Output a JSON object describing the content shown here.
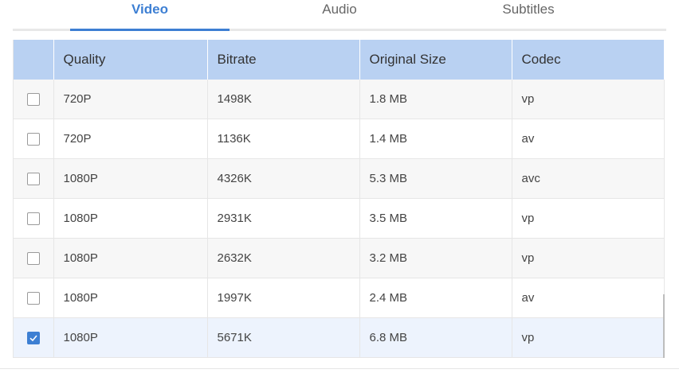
{
  "tabs": [
    {
      "label": "Video",
      "active": true
    },
    {
      "label": "Audio",
      "active": false
    },
    {
      "label": "Subtitles",
      "active": false
    }
  ],
  "table": {
    "headers": [
      "Quality",
      "Bitrate",
      "Original Size",
      "Codec"
    ],
    "rows": [
      {
        "quality": "720P",
        "bitrate": "1498K",
        "size": "1.8 MB",
        "codec": "vp",
        "checked": false
      },
      {
        "quality": "720P",
        "bitrate": "1136K",
        "size": "1.4 MB",
        "codec": "av",
        "checked": false
      },
      {
        "quality": "1080P",
        "bitrate": "4326K",
        "size": "5.3 MB",
        "codec": "avc",
        "checked": false
      },
      {
        "quality": "1080P",
        "bitrate": "2931K",
        "size": "3.5 MB",
        "codec": "vp",
        "checked": false
      },
      {
        "quality": "1080P",
        "bitrate": "2632K",
        "size": "3.2 MB",
        "codec": "vp",
        "checked": false
      },
      {
        "quality": "1080P",
        "bitrate": "1997K",
        "size": "2.4 MB",
        "codec": "av",
        "checked": false
      },
      {
        "quality": "1080P",
        "bitrate": "5671K",
        "size": "6.8 MB",
        "codec": "vp",
        "checked": true
      }
    ]
  },
  "colors": {
    "accent": "#3d7fd3",
    "header_bg": "#b9d1f2",
    "selected_row_bg": "#edf3fd"
  },
  "icons": {
    "checkmark": "checkmark-icon"
  }
}
